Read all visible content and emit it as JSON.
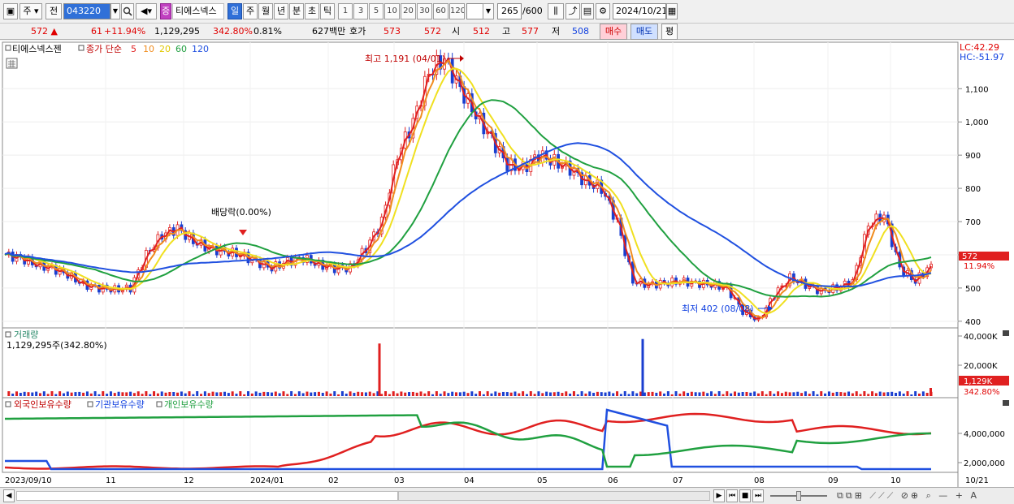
{
  "toolbar": {
    "period_select": "주",
    "prev_label": "전",
    "code": "043220",
    "stock_badge": "증",
    "stock_name": "티에스넥스",
    "period_tabs": [
      "일",
      "주",
      "월",
      "년",
      "분",
      "초",
      "틱"
    ],
    "interval_options": [
      "1",
      "3",
      "5",
      "10",
      "20",
      "30",
      "60",
      "120"
    ],
    "count": "265",
    "count_total": "/600",
    "date": "2024/10/21"
  },
  "quote": {
    "price": "572",
    "change": "61",
    "change_pct": "+11.94%",
    "volume": "1,129,295",
    "volume_ratio": "342.80%",
    "turnover": "0.81%",
    "amount": "627백만",
    "ask_label": "호가",
    "ask": "573",
    "bid": "572",
    "open_label": "시",
    "open": "512",
    "high_label": "고",
    "high": "577",
    "low_label": "저",
    "low": "508",
    "buy_button": "매수",
    "sell_button": "매도",
    "eval_button": "평"
  },
  "price_panel": {
    "title": "티에스넥스젠",
    "ma_label": "종가 단순",
    "ma_periods": [
      "5",
      "10",
      "20",
      "60",
      "120"
    ],
    "ma_colors": [
      "#e02020",
      "#f08c1e",
      "#f0e020",
      "#20a040",
      "#2050e0"
    ],
    "lc": "LC:42.29",
    "hc": "HC:-51.97",
    "high_annotation": "최고 1,191 (04/01)",
    "low_annotation": "최저 402 (08/08)",
    "dividend_annotation": "배당락(0.00%)",
    "price_tag": "572",
    "pct_tag": "11.94%"
  },
  "volume_panel": {
    "title": "거래량",
    "value": "1,129,295주(342.80%)",
    "tag_value": "1,129K",
    "tag_pct": "342.80%"
  },
  "holdings_panel": {
    "series_names": [
      "외국인보유수량",
      "기관보유수량",
      "개인보유수량"
    ]
  },
  "x_axis": {
    "labels": [
      "2023/09/10",
      "11",
      "12",
      "2024/01",
      "02",
      "03",
      "04",
      "05",
      "06",
      "07",
      "08",
      "09",
      "10",
      "10/21"
    ]
  },
  "chart_data": [
    {
      "type": "line",
      "title": "티에스넥스젠",
      "ylim": [
        380,
        1240
      ],
      "y_ticks": [
        400,
        500,
        600,
        700,
        800,
        900,
        1000,
        1100
      ],
      "months_x": [
        "2023/09",
        "10",
        "11",
        "12",
        "2024/01",
        "02",
        "03",
        "04",
        "05",
        "06",
        "07",
        "08",
        "09",
        "10"
      ],
      "close_approx": [
        600,
        590,
        570,
        560,
        540,
        510,
        500,
        495,
        500,
        600,
        660,
        680,
        640,
        620,
        610,
        600,
        580,
        560,
        580,
        590,
        570,
        560,
        560,
        620,
        700,
        900,
        1000,
        1150,
        1191,
        1100,
        1020,
        950,
        870,
        860,
        900,
        880,
        860,
        820,
        800,
        700,
        520,
        510,
        515,
        520,
        515,
        510,
        500,
        430,
        402,
        480,
        530,
        510,
        490,
        500,
        520,
        690,
        720,
        560,
        520,
        572
      ],
      "series": [
        {
          "name": "5",
          "color": "#e02020"
        },
        {
          "name": "10",
          "color": "#f08c1e"
        },
        {
          "name": "20",
          "color": "#f0e020"
        },
        {
          "name": "60",
          "color": "#20a040"
        },
        {
          "name": "120",
          "color": "#2050e0"
        }
      ]
    },
    {
      "type": "bar",
      "title": "거래량",
      "y_ticks": [
        "40,000K",
        "20,000K"
      ],
      "spikes": [
        {
          "month": "03",
          "value": 35000
        },
        {
          "month": "06",
          "value": 38000
        }
      ]
    },
    {
      "type": "line",
      "y_ticks": [
        "4,000,000",
        "2,000,000"
      ],
      "series": [
        {
          "name": "외국인보유수량",
          "color": "#e02020"
        },
        {
          "name": "기관보유수량",
          "color": "#2050e0"
        },
        {
          "name": "개인보유수량",
          "color": "#20a040"
        }
      ]
    }
  ]
}
